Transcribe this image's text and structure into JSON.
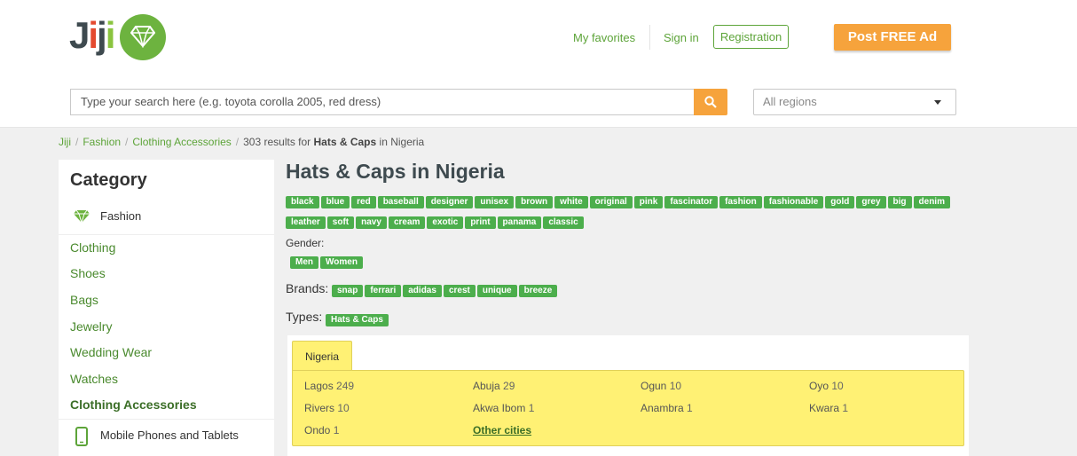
{
  "header": {
    "logo_text": "Jiji",
    "my_favorites": "My favorites",
    "sign_in": "Sign in",
    "registration": "Registration",
    "post_ad": "Post FREE Ad",
    "search_placeholder": "Type your search here (e.g. toyota corolla 2005, red dress)",
    "region_placeholder": "All regions"
  },
  "breadcrumb": {
    "items": [
      "Jiji",
      "Fashion",
      "Clothing Accessories"
    ],
    "count_text": "303 results for ",
    "query": "Hats & Caps",
    "suffix": " in Nigeria"
  },
  "sidebar": {
    "title": "Category",
    "parent": "Fashion",
    "items": [
      "Clothing",
      "Shoes",
      "Bags",
      "Jewelry",
      "Wedding Wear",
      "Watches",
      "Clothing Accessories"
    ],
    "next_category": "Mobile Phones and Tablets"
  },
  "main": {
    "title": "Hats & Caps in Nigeria",
    "tags": [
      "black",
      "blue",
      "red",
      "baseball",
      "designer",
      "unisex",
      "brown",
      "white",
      "original",
      "pink",
      "fascinator",
      "fashion",
      "fashionable",
      "gold",
      "grey",
      "big",
      "denim",
      "leather",
      "soft",
      "navy",
      "cream",
      "exotic",
      "print",
      "panama",
      "classic"
    ],
    "gender_label": "Gender:",
    "gender": [
      "Men",
      "Women"
    ],
    "brands_label": "Brands:",
    "brands": [
      "snap",
      "ferrari",
      "adidas",
      "crest",
      "unique",
      "breeze"
    ],
    "types_label": "Types:",
    "types": [
      "Hats & Caps"
    ]
  },
  "locations": {
    "tab": "Nigeria",
    "cities": [
      {
        "name": "Lagos",
        "count": "249"
      },
      {
        "name": "Abuja",
        "count": "29"
      },
      {
        "name": "Ogun",
        "count": "10"
      },
      {
        "name": "Oyo",
        "count": "10"
      },
      {
        "name": "Rivers",
        "count": "10"
      },
      {
        "name": "Akwa Ibom",
        "count": "1"
      },
      {
        "name": "Anambra",
        "count": "1"
      },
      {
        "name": "Kwara",
        "count": "1"
      },
      {
        "name": "Ondo",
        "count": "1"
      }
    ],
    "other": "Other cities"
  },
  "colors": {
    "brand_green": "#5da439",
    "tag_green": "#4cae4c",
    "accent_orange": "#f6a33c",
    "location_yellow": "#fff174"
  }
}
